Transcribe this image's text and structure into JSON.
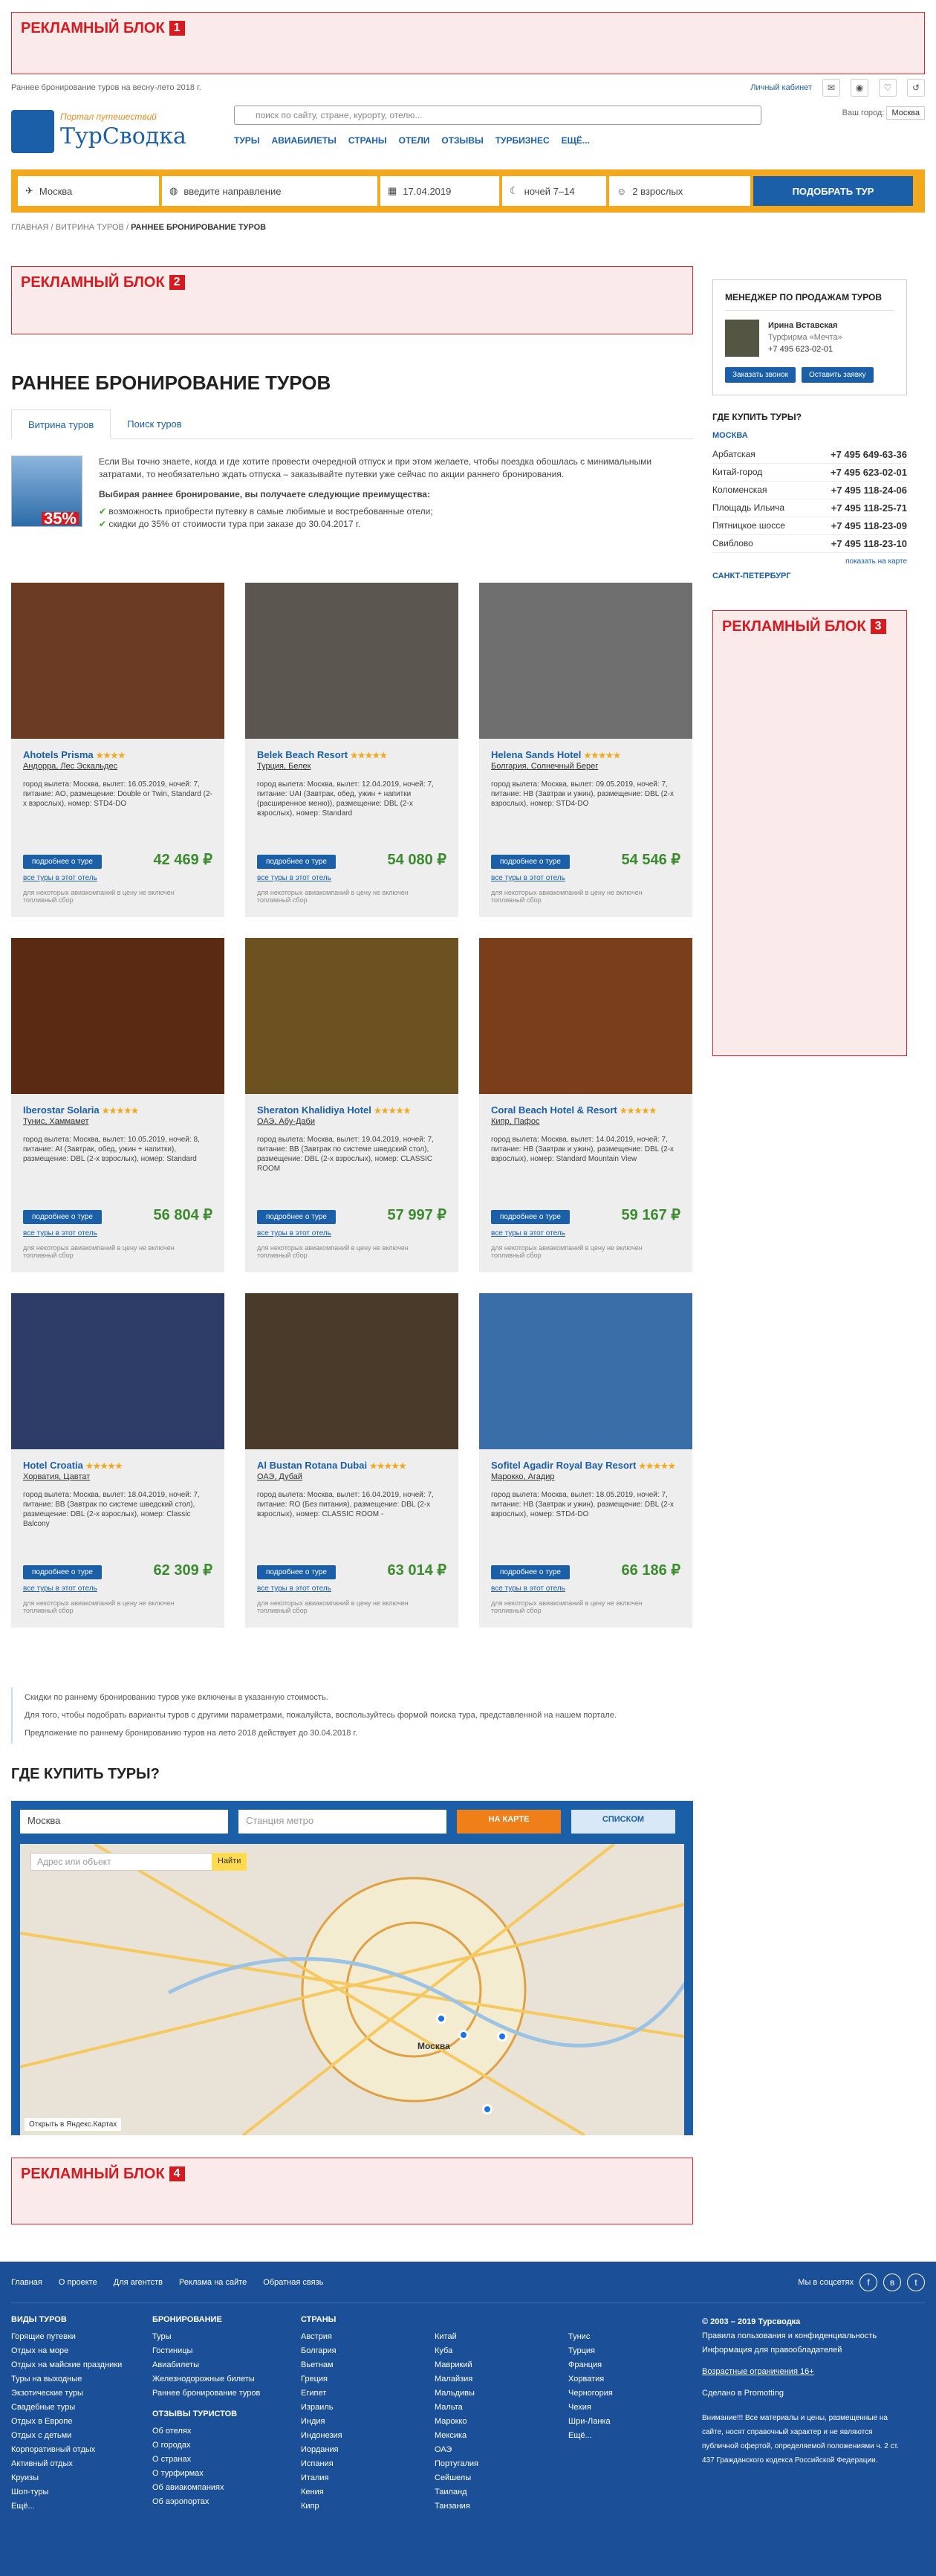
{
  "ads": {
    "label": "РЕКЛАМНЫЙ БЛОК",
    "n1": "1",
    "n2": "2",
    "n3": "3",
    "n4": "4"
  },
  "topline": {
    "text": "Раннее бронирование туров на весну-лето 2018 г.",
    "cabinet": "Личный кабинет"
  },
  "logo": {
    "sub": "Портал путешествий",
    "name": "ТурСводка"
  },
  "search": {
    "placeholder": "поиск по сайту, стране, курорту, отелю..."
  },
  "city": {
    "label": "Ваш город:",
    "value": "Москва"
  },
  "nav": [
    "ТУРЫ",
    "АВИАБИЛЕТЫ",
    "СТРАНЫ",
    "ОТЕЛИ",
    "ОТЗЫВЫ",
    "ТУРБИЗНЕС",
    "ЕЩЁ..."
  ],
  "tourbar": {
    "from": "Москва",
    "to": "введите направление",
    "date": "17.04.2019",
    "nights": "ночей 7–14",
    "people": "2 взрослых",
    "submit": "ПОДОБРАТЬ ТУР"
  },
  "crumbs": [
    "ГЛАВНАЯ",
    "ВИТРИНА ТУРОВ",
    "РАННЕЕ БРОНИРОВАНИЕ ТУРОВ"
  ],
  "page": {
    "title": "РАННЕЕ БРОНИРОВАНИЕ ТУРОВ",
    "tab1": "Витрина туров",
    "tab2": "Поиск туров"
  },
  "intro": {
    "text": "Если Вы точно знаете, когда и где хотите провести очередной отпуск и при этом желаете, чтобы поездка обошлась с минимальными затратами, то необязательно ждать отпуска – заказывайте путевки уже сейчас по акции раннего бронирования.",
    "bold": "Выбирая раннее бронирование, вы получаете следующие преимущества:",
    "li1": "возможность приобрести путевку в самые любимые и востребованные отели;",
    "li2": "скидки до 35% от стоимости тура при заказе до 30.04.2017 г.",
    "pct": "35%"
  },
  "card_common": {
    "more": "подробнее о туре",
    "all": "все туры в этот отель",
    "note": "для некоторых авиакомпаний в цену не включен топливный сбор"
  },
  "cards": [
    {
      "name": "Ahotels Prisma",
      "stars": "★★★★",
      "loc": "Андорра, Лес Эскальдес",
      "desc": "город вылета: Москва, вылет: 16.05.2019, ночей: 7, питание: AO, размещение: Double or Twin, Standard (2-х взрослых), номер: STD4-DO",
      "price": "42 469 ₽",
      "color": "#6a3a22"
    },
    {
      "name": "Belek Beach Resort",
      "stars": "★★★★★",
      "loc": "Турция, Белек",
      "desc": "город вылета: Москва, вылет: 12.04.2019, ночей: 7, питание: UAI (Завтрак, обед, ужин + напитки (расширенное меню)), размещение: DBL (2-х взрослых), номер: Standard",
      "price": "54 080 ₽",
      "color": "#5b5650"
    },
    {
      "name": "Helena Sands Hotel",
      "stars": "★★★★★",
      "loc": "Болгария, Солнечный Берег",
      "desc": "город вылета: Москва, вылет: 09.05.2019, ночей: 7, питание: HB (Завтрак и ужин), размещение: DBL (2-х взрослых), номер: STD4-DO",
      "price": "54 546 ₽",
      "color": "#6e6e6e"
    },
    {
      "name": "Iberostar Solaria",
      "stars": "★★★★★",
      "loc": "Тунис, Хаммамет",
      "desc": "город вылета: Москва, вылет: 10.05.2019, ночей: 8, питание: AI (Завтрак, обед, ужин + напитки), размещение: DBL (2-х взрослых), номер: Standard",
      "price": "56 804 ₽",
      "color": "#5a2a12"
    },
    {
      "name": "Sheraton Khalidiya Hotel",
      "stars": "★★★★★",
      "loc": "ОАЭ, Абу-Даби",
      "desc": "город вылета: Москва, вылет: 19.04.2019, ночей: 7, питание: BB (Завтрак по системе шведский стол), размещение: DBL (2-х взрослых), номер: CLASSIC ROOM",
      "price": "57 997 ₽",
      "color": "#6b5220"
    },
    {
      "name": "Coral Beach Hotel & Resort",
      "stars": "★★★★★",
      "loc": "Кипр, Пафос",
      "desc": "город вылета: Москва, вылет: 14.04.2019, ночей: 7, питание: HB (Завтрак и ужин), размещение: DBL (2-х взрослых), номер: Standard Mountain View",
      "price": "59 167 ₽",
      "color": "#7a3f1a"
    },
    {
      "name": "Hotel Croatia",
      "stars": "★★★★★",
      "loc": "Хорватия, Цавтат",
      "desc": "город вылета: Москва, вылет: 18.04.2019, ночей: 7, питание: BB (Завтрак по системе шведский стол), размещение: DBL (2-х взрослых), номер: Classic Balcony",
      "price": "62 309 ₽",
      "color": "#2c3c66"
    },
    {
      "name": "Al Bustan Rotana Dubai",
      "stars": "★★★★★",
      "loc": "ОАЭ, Дубай",
      "desc": "город вылета: Москва, вылет: 16.04.2019, ночей: 7, питание: RO (Без питания), размещение: DBL (2-х взрослых), номер: CLASSIC ROOM -",
      "price": "63 014 ₽",
      "color": "#4a3a2a"
    },
    {
      "name": "Sofitel Agadir Royal Bay Resort",
      "stars": "★★★★★",
      "loc": "Марокко, Агадир",
      "desc": "город вылета: Москва, вылет: 18.05.2019, ночей: 7, питание: HB (Завтрак и ужин), размещение: DBL (2-х взрослых), номер: STD4-DO",
      "price": "66 186 ₽",
      "color": "#3a6ea8"
    }
  ],
  "info": {
    "l1": "Скидки по раннему бронированию туров уже включены в указанную стоимость.",
    "l2": "Для того, чтобы подобрать варианты туров с другими параметрами, пожалуйста, воспользуйтесь формой поиска тура, представленной на нашем портале.",
    "l3": "Предложение по раннему бронированию туров на лето 2018 действует до 30.04.2018 г."
  },
  "where": {
    "title": "ГДЕ КУПИТЬ ТУРЫ?",
    "city": "Москва",
    "metro": "Станция метро",
    "on_map": "НА КАРТЕ",
    "list": "СПИСКОМ",
    "addr": "Адрес или объект",
    "find": "Найти",
    "map_city": "Москва",
    "open": "Открыть в Яндекс.Картах"
  },
  "manager": {
    "title": "МЕНЕДЖЕР ПО ПРОДАЖАМ ТУРОВ",
    "name": "Ирина Вставская",
    "firm": "Турфирма «Мечта»",
    "phone": "+7 495 623-02-01",
    "call": "Заказать звонок",
    "req": "Оставить заявку"
  },
  "buy": {
    "title": "ГДЕ КУПИТЬ ТУРЫ?",
    "moscow": "МОСКВА",
    "spb": "САНКТ-ПЕТЕРБУРГ",
    "map": "показать на карте",
    "rows": [
      {
        "n": "Арбатская",
        "p": "+7 495 649-63-36"
      },
      {
        "n": "Китай-город",
        "p": "+7 495 623-02-01"
      },
      {
        "n": "Коломенская",
        "p": "+7 495 118-24-06"
      },
      {
        "n": "Площадь Ильича",
        "p": "+7 495 118-25-71"
      },
      {
        "n": "Пятницкое шоссе",
        "p": "+7 495 118-23-09"
      },
      {
        "n": "Свиблово",
        "p": "+7 495 118-23-10"
      }
    ]
  },
  "footer": {
    "links": [
      "Главная",
      "О проекте",
      "Для агентств",
      "Реклама на сайте",
      "Обратная связь"
    ],
    "social": "Мы в соцсетях",
    "c1h": "ВИДЫ ТУРОВ",
    "c1": [
      "Горящие путевки",
      "Отдых на море",
      "Отдых на майские праздники",
      "Туры на выходные",
      "Экзотические туры",
      "Свадебные туры",
      "Отдых в Европе",
      "Отдых с детьми",
      "Корпоративный отдых",
      "Активный отдых",
      "Круизы",
      "Шоп-туры",
      "Ещё..."
    ],
    "c2h": "БРОНИРОВАНИЕ",
    "c2": [
      "Туры",
      "Гостиницы",
      "Авиабилеты",
      "Железнодорожные билеты",
      "Раннее бронирование туров"
    ],
    "c2bh": "ОТЗЫВЫ ТУРИСТОВ",
    "c2b": [
      "Об отелях",
      "О городах",
      "О странах",
      "О турфирмах",
      "Об авиакомпаниях",
      "Об аэропортах"
    ],
    "c3h": "СТРАНЫ",
    "c3": [
      "Австрия",
      "Болгария",
      "Вьетнам",
      "Греция",
      "Египет",
      "Израиль",
      "Индия",
      "Индонезия",
      "Иордания",
      "Испания",
      "Италия",
      "Кения",
      "Кипр"
    ],
    "c4": [
      "Китай",
      "Куба",
      "Маврикий",
      "Малайзия",
      "Мальдивы",
      "Мальта",
      "Марокко",
      "Мексика",
      "ОАЭ",
      "Португалия",
      "Сейшелы",
      "Таиланд",
      "Танзания"
    ],
    "c5": [
      "Тунис",
      "Турция",
      "Франция",
      "Хорватия",
      "Черногория",
      "Чехия",
      "Шри-Ланка",
      "Ещё..."
    ],
    "copy": "© 2003 – 2019 Турсводка",
    "priv": "Правила пользования и конфиденциальность",
    "info": "Информация для правообладателей",
    "warn": "Внимание!!! Все материалы и цены, размещенные на сайте, носят справочный характер и не являются публичной офертой, определяемой положениями ч. 2 ст. 437 Гражданского кодекса Российской Федерации.",
    "age": "Возрастные ограничения 16+",
    "dev": "Сделано в Promotting"
  }
}
